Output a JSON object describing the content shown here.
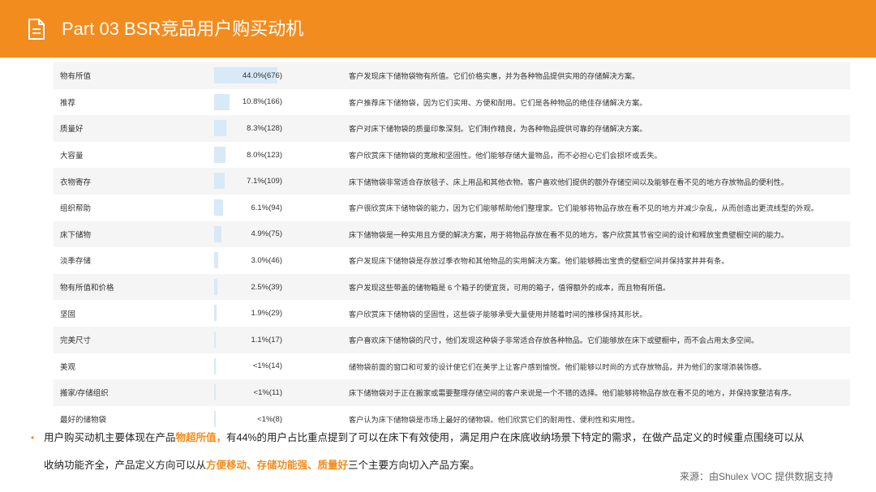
{
  "header": {
    "title": "Part 03  BSR竞品用户购买动机",
    "icon": "document-icon",
    "color": "#f28c1f"
  },
  "rows": [
    {
      "name": "物有所值",
      "pct": "44.0%(676)",
      "value": 44.0,
      "desc": "客户发现床下储物袋物有所值。它们价格实惠，并为各种物品提供实用的存储解决方案。"
    },
    {
      "name": "推荐",
      "pct": "10.8%(166)",
      "value": 10.8,
      "desc": "客户推荐床下储物袋，因为它们实用、方便和耐用。它们是各种物品的绝佳存储解决方案。"
    },
    {
      "name": "质量好",
      "pct": "8.3%(128)",
      "value": 8.3,
      "desc": "客户对床下储物袋的质量印象深刻。它们制作精良，为各种物品提供可靠的存储解决方案。"
    },
    {
      "name": "大容量",
      "pct": "8.0%(123)",
      "value": 8.0,
      "desc": "客户欣赏床下储物袋的宽敞和坚固性。他们能够存储大量物品，而不必担心它们会损坏或丢失。"
    },
    {
      "name": "衣物寄存",
      "pct": "7.1%(109)",
      "value": 7.1,
      "desc": "床下储物袋非常适合存放毯子、床上用品和其他衣物。客户喜欢他们提供的额外存储空间以及能够在看不见的地方存放物品的便利性。"
    },
    {
      "name": "组织帮助",
      "pct": "6.1%(94)",
      "value": 6.1,
      "desc": "客户很欣赏床下储物袋的能力，因为它们能够帮助他们整理家。它们能够将物品存放在看不见的地方并减少杂乱，从而创造出更流线型的外观。"
    },
    {
      "name": "床下储物",
      "pct": "4.9%(75)",
      "value": 4.9,
      "desc": "床下储物袋是一种实用且方便的解决方案，用于将物品存放在看不见的地方。客户欣赏其节省空间的设计和释放宝贵壁橱空间的能力。"
    },
    {
      "name": "淡季存储",
      "pct": "3.0%(46)",
      "value": 3.0,
      "desc": "客户发现床下储物袋是存放过季衣物和其他物品的实用解决方案。他们能够腾出宝贵的壁橱空间并保持家井井有条。"
    },
    {
      "name": "物有所值和价格",
      "pct": "2.5%(39)",
      "value": 2.5,
      "desc": "客户发现这些带盖的储物箱是 6 个箱子的便宜货，可用的箱子，值得额外的成本，而且物有所值。"
    },
    {
      "name": "坚固",
      "pct": "1.9%(29)",
      "value": 1.9,
      "desc": "客户欣赏床下储物袋的坚固性，这些袋子能够承受大量使用并随着时间的推移保持其形状。"
    },
    {
      "name": "完美尺寸",
      "pct": "1.1%(17)",
      "value": 1.1,
      "desc": "客户喜欢床下储物袋的尺寸，他们发现这种袋子非常适合存放各种物品。它们能够放在床下或壁橱中，而不会占用太多空间。"
    },
    {
      "name": "美观",
      "pct": "<1%(14)",
      "value": 0.9,
      "desc": "储物袋前面的窗口和可爱的设计使它们在美学上让客户感到愉悦。他们能够以时尚的方式存放物品，并为他们的家增添装饰感。"
    },
    {
      "name": "搬家/存储组织",
      "pct": "<1%(11)",
      "value": 0.7,
      "desc": "床下储物袋对于正在搬家或需要整理存储空间的客户来说是一个不错的选择。他们能够将物品存放在看不见的地方，并保持家整洁有序。"
    },
    {
      "name": "最好的储物袋",
      "pct": "<1%(8)",
      "value": 0.5,
      "desc": "客户认为床下储物袋是市场上最好的储物袋。他们欣赏它们的耐用性、便利性和实用性。"
    }
  ],
  "summary": {
    "bullet": "•",
    "line1_a": "用户购买动机主要体现在产品",
    "line1_hl": "物超所值，",
    "line1_b": "有44%的用户占比重点提到了可以在床下有效使用，满足用户在床底收纳场景下特定的需求，在做产品定义的时候重点围绕可以从",
    "line2_a": "收纳功能齐全，产品定义方向可以从",
    "line2_hl": "方便移动、存储功能强、质量好",
    "line2_b": "三个主要方向切入产品方案。"
  },
  "source": "来源：由Shulex VOC 提供数据支持"
}
